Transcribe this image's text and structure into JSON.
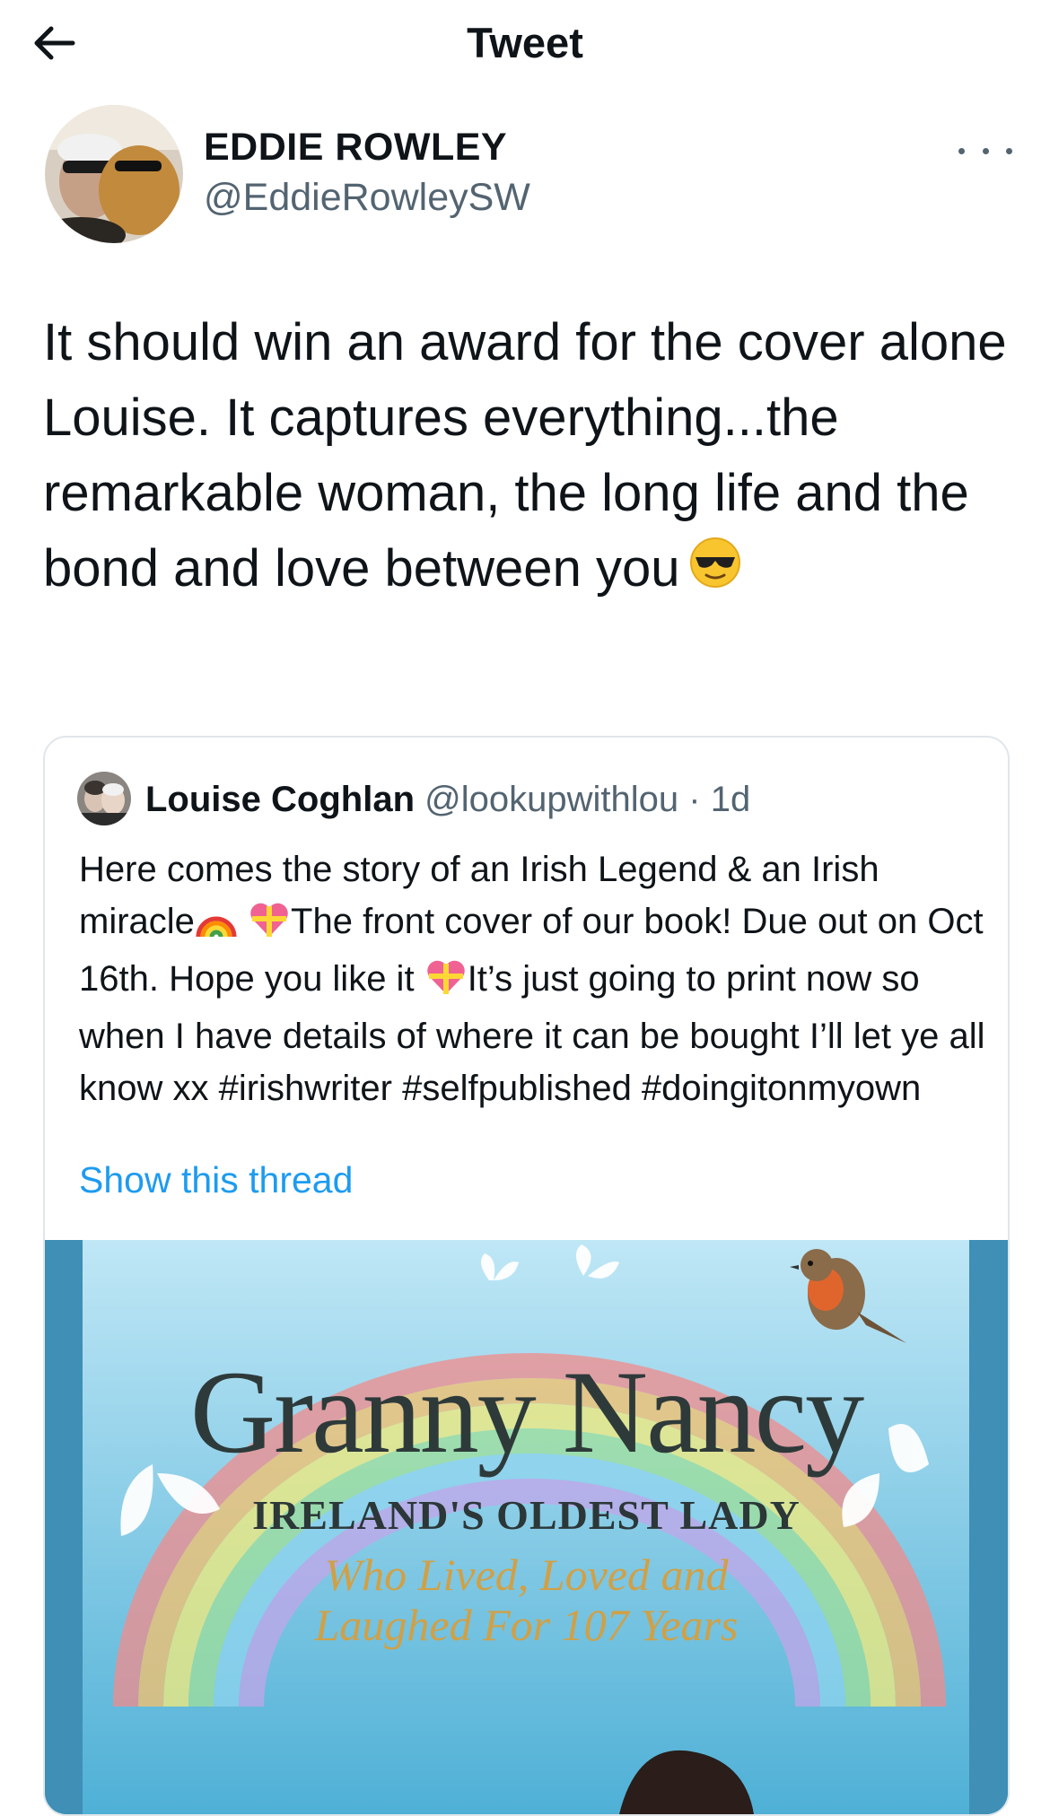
{
  "header": {
    "title": "Tweet"
  },
  "tweet": {
    "author_name": "EDDIE ROWLEY",
    "author_handle": "@EddieRowleySW",
    "text": "It should win an award for the cover alone Louise. It captures everything...the remarkable woman, the long life and the bond and love between you"
  },
  "quoted_tweet": {
    "author_name": "Louise Coghlan",
    "author_handle": "@lookupwithlou",
    "separator": "·",
    "time": "1d",
    "text_part1": "Here comes the story of an Irish Legend & an Irish miracle",
    "text_part2": "The front cover of our book! Due out on Oct 16th. Hope you like it",
    "text_part3": "It’s just going to print now so when I have details of where it can be bought I’ll let ye all know xx #irishwriter #selfpublished #doingitonmyown",
    "show_thread_label": "Show this thread"
  },
  "book_cover": {
    "title": "Granny Nancy",
    "subtitle": "IRELAND'S OLDEST LADY",
    "tagline_line1": "Who Lived, Loved and",
    "tagline_line2": "Laughed For 107 Years"
  },
  "icons": {
    "back": "arrow-left-icon",
    "more": "more-horizontal-icon",
    "emoji_cool": "sunglasses-face-icon",
    "emoji_rainbow": "rainbow-icon",
    "emoji_heart": "heart-with-ribbon-icon"
  },
  "colors": {
    "link": "#1d9bf0",
    "secondary_text": "#536471",
    "primary_text": "#0f1419",
    "border": "#e1e6ea"
  }
}
